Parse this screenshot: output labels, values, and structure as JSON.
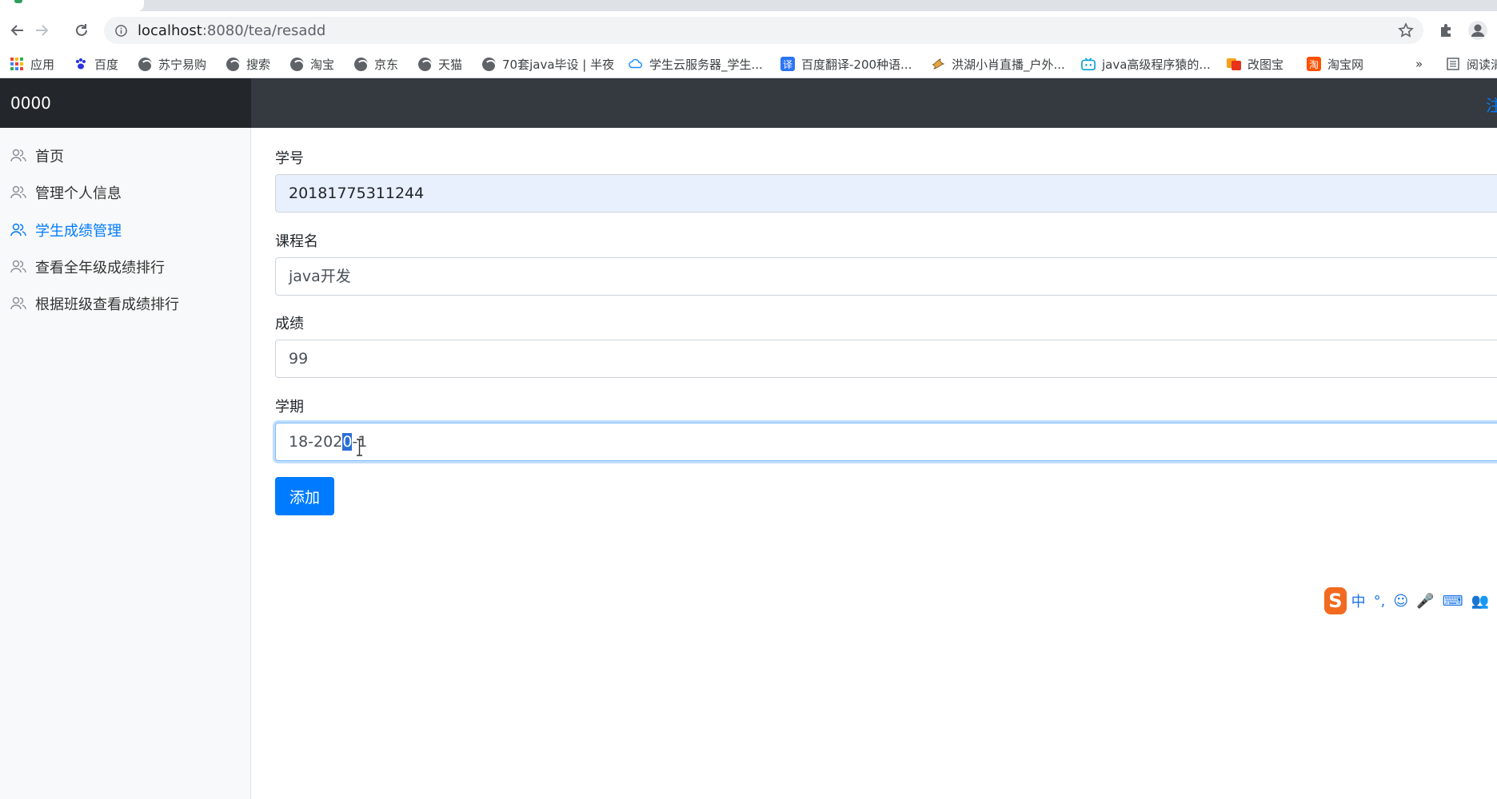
{
  "browser": {
    "url_host": "localhost",
    "url_path": ":8080/tea/resadd",
    "bookmarks": [
      {
        "label": "应用",
        "icon": "apps-grid-icon"
      },
      {
        "label": "百度",
        "icon": "baidu-paw-icon"
      },
      {
        "label": "苏宁易购",
        "icon": "globe-icon"
      },
      {
        "label": "搜索",
        "icon": "globe-icon"
      },
      {
        "label": "淘宝",
        "icon": "globe-icon"
      },
      {
        "label": "京东",
        "icon": "globe-icon"
      },
      {
        "label": "天猫",
        "icon": "globe-icon"
      },
      {
        "label": "70套java毕设 | 半夜",
        "icon": "globe-icon"
      },
      {
        "label": "学生云服务器_学生...",
        "icon": "cloud-icon"
      },
      {
        "label": "百度翻译-200种语...",
        "icon": "translate-icon"
      },
      {
        "label": "洪湖小肖直播_户外...",
        "icon": "bird-icon"
      },
      {
        "label": "java高级程序猿的...",
        "icon": "bilibili-icon"
      },
      {
        "label": "改图宝",
        "icon": "image-edit-icon"
      },
      {
        "label": "淘宝网",
        "icon": "taobao-icon"
      },
      {
        "label": "»",
        "icon": ""
      },
      {
        "label": "阅读清",
        "icon": "reading-list-icon"
      }
    ]
  },
  "app": {
    "brand": "0000",
    "header_link": "注"
  },
  "sidebar": {
    "items": [
      {
        "label": "首页",
        "active": false
      },
      {
        "label": "管理个人信息",
        "active": false
      },
      {
        "label": "学生成绩管理",
        "active": true
      },
      {
        "label": "查看全年级成绩排行",
        "active": false
      },
      {
        "label": "根据班级查看成绩排行",
        "active": false
      }
    ]
  },
  "form": {
    "student_id_label": "学号",
    "student_id_value": "20181775311244",
    "course_label": "课程名",
    "course_value": "java开发",
    "score_label": "成绩",
    "score_value": "99",
    "term_label": "学期",
    "term_value_before": "18-202",
    "term_value_selected": "0",
    "term_value_after": "-1",
    "submit_label": "添加"
  },
  "ime": {
    "logo": "S",
    "mode": "中",
    "symbols": [
      "°,",
      "☺",
      "🎤",
      "⌨",
      "👥"
    ]
  },
  "colors": {
    "primary": "#007bff",
    "header_bg": "#343a40",
    "brand_bg": "#23272b",
    "sidebar_bg": "#f8f9fa"
  }
}
